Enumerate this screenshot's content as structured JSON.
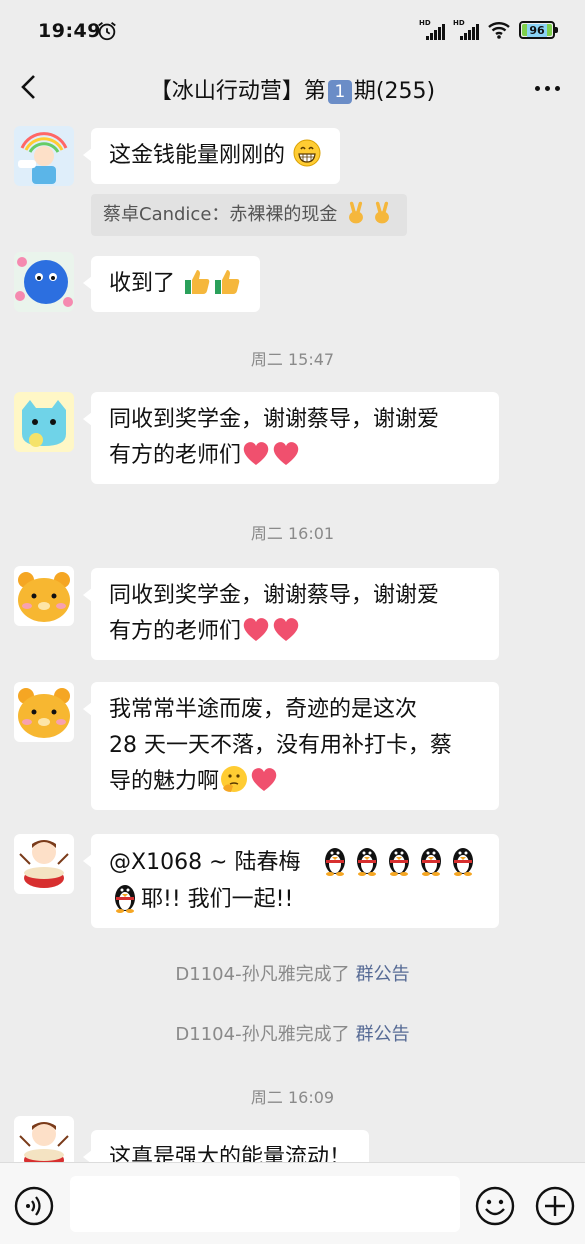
{
  "status_bar": {
    "time": "19:49",
    "network_1": "HD",
    "network_2": "HD",
    "battery": "96",
    "icons": [
      "alarm-icon",
      "signal-icon",
      "signal-icon",
      "wifi-icon",
      "battery-icon"
    ]
  },
  "header": {
    "title_prefix": "【冰山行动营】第",
    "title_badge": "1",
    "title_suffix": "期(255)",
    "back_icon": "back-chevron-icon",
    "more_icon": "more-dots-icon"
  },
  "messages": [
    {
      "type": "text",
      "avatar": "avatar-rainbow-boy",
      "text": "这金钱能量刚刚的",
      "emoji": [
        "grin-emoji"
      ]
    },
    {
      "type": "quote",
      "text": "蔡卓Candice：赤裸裸的现金",
      "emoji": [
        "victory-emoji",
        "victory-emoji"
      ]
    },
    {
      "type": "text",
      "avatar": "avatar-blue-fluffy",
      "text": "收到了",
      "emoji": [
        "thumbs-up-emoji",
        "thumbs-up-emoji"
      ]
    },
    {
      "type": "time",
      "text": "周二 15:47"
    },
    {
      "type": "text",
      "avatar": "avatar-blue-cat",
      "line1": "同收到奖学金，谢谢蔡导，谢谢爱",
      "line2": "有方的老师们",
      "emoji": [
        "heart-emoji",
        "heart-emoji"
      ]
    },
    {
      "type": "time",
      "text": "周二 16:01"
    },
    {
      "type": "text",
      "avatar": "avatar-bear-1",
      "line1": "同收到奖学金，谢谢蔡导，谢谢爱",
      "line2": "有方的老师们",
      "emoji": [
        "heart-emoji",
        "heart-emoji"
      ]
    },
    {
      "type": "text",
      "avatar": "avatar-bear-2",
      "line1": "我常常半途而废，奇迹的是这次",
      "line2": "28 天一天不落，没有用补打卡，蔡",
      "line3": "导的魅力啊",
      "emoji": [
        "thinking-emoji",
        "heart-emoji"
      ]
    },
    {
      "type": "text",
      "avatar": "avatar-drum-girl-1",
      "line1": "@X1068 ~ 陆春梅",
      "line2": "耶!! 我们一起!!",
      "emoji": [
        "penguin-emoji",
        "penguin-emoji",
        "penguin-emoji",
        "penguin-emoji",
        "penguin-emoji",
        "penguin-emoji"
      ]
    },
    {
      "type": "system",
      "text": "D1104-孙凡雅完成了",
      "link": "群公告"
    },
    {
      "type": "system",
      "text": "D1104-孙凡雅完成了",
      "link": "群公告"
    },
    {
      "type": "time",
      "text": "周二 16:09"
    },
    {
      "type": "text",
      "avatar": "avatar-drum-girl-2",
      "text": "这真是强大的能量流动！"
    }
  ],
  "input_bar": {
    "placeholder": "",
    "voice_icon": "voice-icon",
    "emoji_icon": "emoji-smile-icon",
    "plus_icon": "plus-icon"
  }
}
